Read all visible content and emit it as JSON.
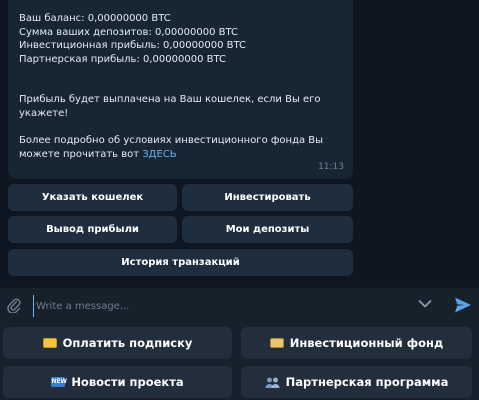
{
  "message": {
    "lines": [
      "Ваш баланс: 0,00000000 BTC",
      "Сумма ваших депозитов: 0,00000000 BTC",
      "Инвестиционная прибыль: 0,00000000 BTC",
      "Партнерская прибыль: 0,00000000 BTC"
    ],
    "payout_line1": "Прибыль будет выплачена на Ваш кошелек, если Вы его",
    "payout_line2": "укажете!",
    "details_line1": "Более подробно об условиях инвестиционного фонда Вы",
    "details_line2_prefix": "можете прочитать вот ",
    "details_link": "ЗДЕСЬ",
    "time": "11:13"
  },
  "inline_keyboard": {
    "set_wallet": "Указать кошелек",
    "invest": "Инвестировать",
    "withdraw": "Вывод прибыли",
    "my_deposits": "Мои депозиты",
    "history": "История транзакций"
  },
  "input": {
    "placeholder": "Write a message..."
  },
  "reply_keyboard": {
    "pay_subscription": "Оплатить подписку",
    "investment_fund": "Инвестиционный фонд",
    "project_news": "Новости проекта",
    "partner_program": "Партнерская программа",
    "new_badge": "NEW"
  },
  "colors": {
    "background": "#0e1621",
    "bubble": "#182533",
    "link": "#6ab3f3",
    "inline_button": "#1f2e3e",
    "keyboard_button": "#232e3c"
  }
}
